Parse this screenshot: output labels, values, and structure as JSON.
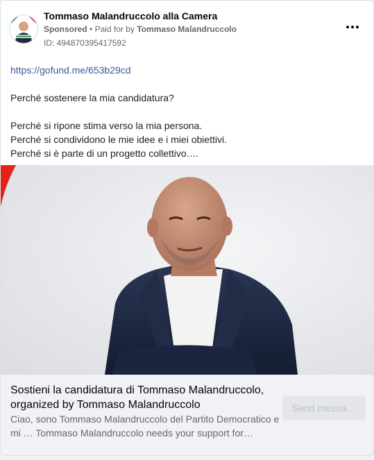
{
  "post": {
    "page_name": "Tommaso Malandruccolo alla Camera",
    "sponsored_label": "Sponsored",
    "separator": "•",
    "paid_for_prefix": "Paid for by",
    "paid_for_name": "Tommaso Malandruccolo",
    "ad_id": "ID: 494870395417592",
    "more_icon": "more-horizontal-icon"
  },
  "body": {
    "link": "https://gofund.me/653b29cd",
    "question": "Perché sostenere la mia candidatura?",
    "reasons": [
      "Perché si ripone stima verso la mia persona.",
      "Perché si condividono le mie idee e i miei obiettivi.",
      "Perché si è parte di un progetto collettivo.…"
    ]
  },
  "link_preview": {
    "title": "Sostieni la candidatura di Tommaso Malandruccolo, organized by Tommaso Malandruccolo",
    "description": "Ciao, sono Tommaso Malandruccolo del Partito Democratico e mi … Tommaso Malandruccolo needs your support for…",
    "cta_label": "Send messa…"
  },
  "colors": {
    "link": "#385898",
    "muted": "#65676b",
    "footer_bg": "#f0f2f5",
    "cta_bg": "#e4e6eb",
    "accent_red": "#e2231a",
    "suit_navy": "#1f2a44"
  }
}
